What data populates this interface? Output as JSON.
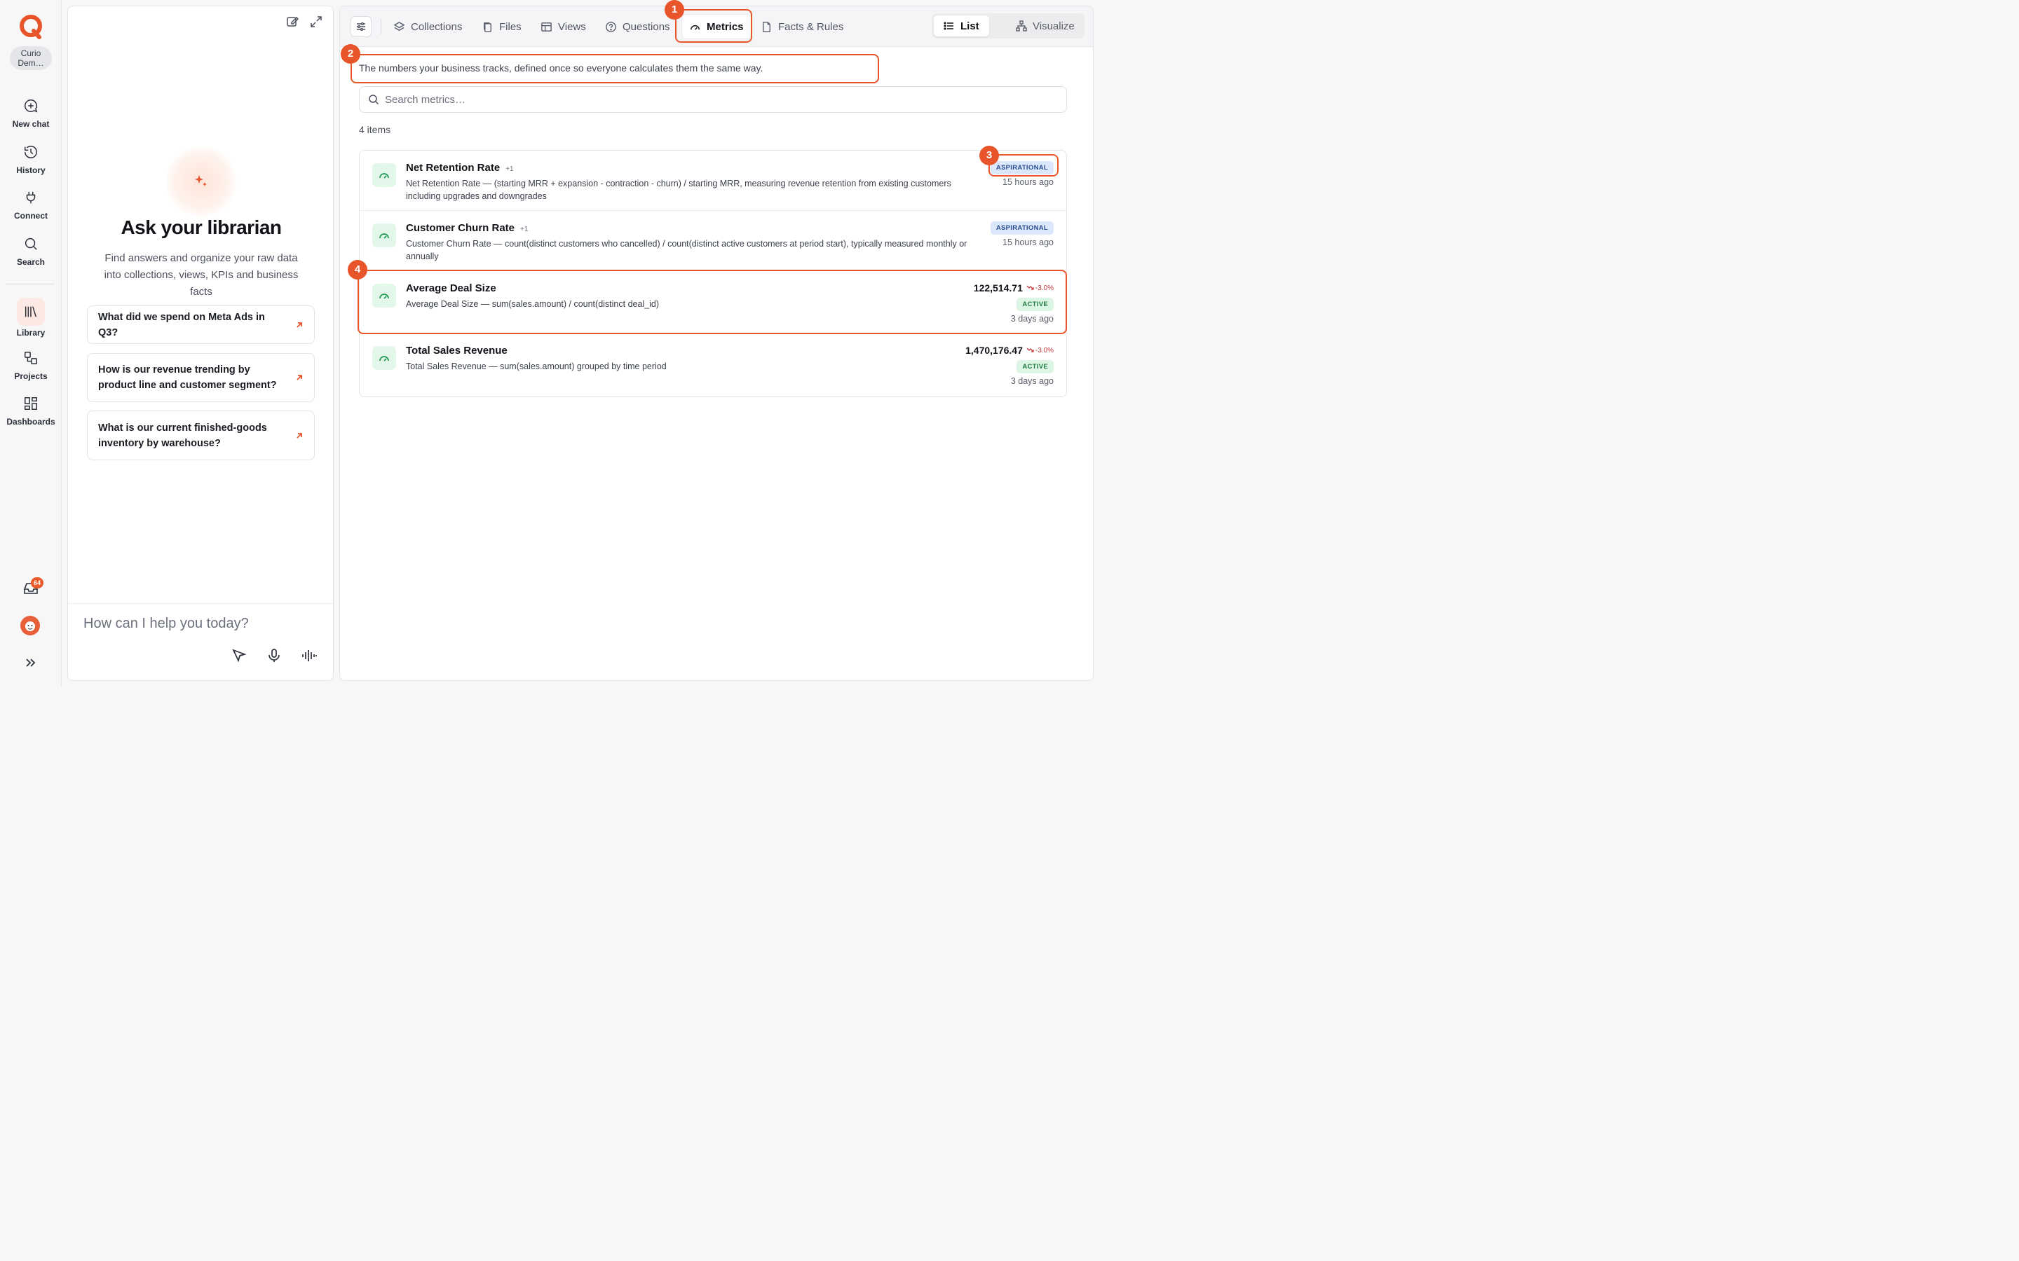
{
  "rail": {
    "org": "Curio Dem…",
    "items": [
      {
        "label": "New chat"
      },
      {
        "label": "History"
      },
      {
        "label": "Connect"
      },
      {
        "label": "Search"
      },
      {
        "label": "Library"
      },
      {
        "label": "Projects"
      },
      {
        "label": "Dashboards"
      }
    ],
    "inbox_count": "64"
  },
  "chat": {
    "title": "Ask your librarian",
    "subtitle": "Find answers and organize your raw data into collections, views, KPIs and business facts",
    "suggestions": [
      "What did we spend on Meta Ads in Q3?",
      "How is our revenue trending by product line and customer segment?",
      "What is our current finished-goods inventory by warehouse?"
    ],
    "input_placeholder": "How can I help you today?"
  },
  "toolbar": {
    "tabs": [
      "Collections",
      "Files",
      "Views",
      "Questions",
      "Metrics",
      "Facts & Rules"
    ],
    "active_tab": "Metrics",
    "view_list": "List",
    "view_visualize": "Visualize"
  },
  "metrics": {
    "description": "The numbers your business tracks, defined once so everyone calculates them the same way.",
    "search_placeholder": "Search metrics…",
    "count": "4 items",
    "rows": [
      {
        "title": "Net Retention Rate",
        "plus": "+1",
        "desc": "Net Retention Rate — (starting MRR + expansion - contraction - churn) / starting MRR, measuring revenue retention from existing customers including upgrades and downgrades",
        "value": "",
        "delta": "",
        "status": "ASPIRATIONAL",
        "time": "15 hours ago"
      },
      {
        "title": "Customer Churn Rate",
        "plus": "+1",
        "desc": "Customer Churn Rate — count(distinct customers who cancelled) / count(distinct active customers at period start), typically measured monthly or annually",
        "value": "",
        "delta": "",
        "status": "ASPIRATIONAL",
        "time": "15 hours ago"
      },
      {
        "title": "Average Deal Size",
        "plus": "",
        "desc": "Average Deal Size — sum(sales.amount) / count(distinct deal_id)",
        "value": "122,514.71",
        "delta": "-3.0%",
        "status": "ACTIVE",
        "time": "3 days ago"
      },
      {
        "title": "Total Sales Revenue",
        "plus": "",
        "desc": "Total Sales Revenue — sum(sales.amount) grouped by time period",
        "value": "1,470,176.47",
        "delta": "-3.0%",
        "status": "ACTIVE",
        "time": "3 days ago"
      }
    ]
  },
  "annotations": [
    "1",
    "2",
    "3",
    "4"
  ],
  "colors": {
    "accent": "#e8552a",
    "active_green": "#1f7a3f",
    "aspirational_blue": "#2a4d8f",
    "negative": "#c2373a"
  }
}
